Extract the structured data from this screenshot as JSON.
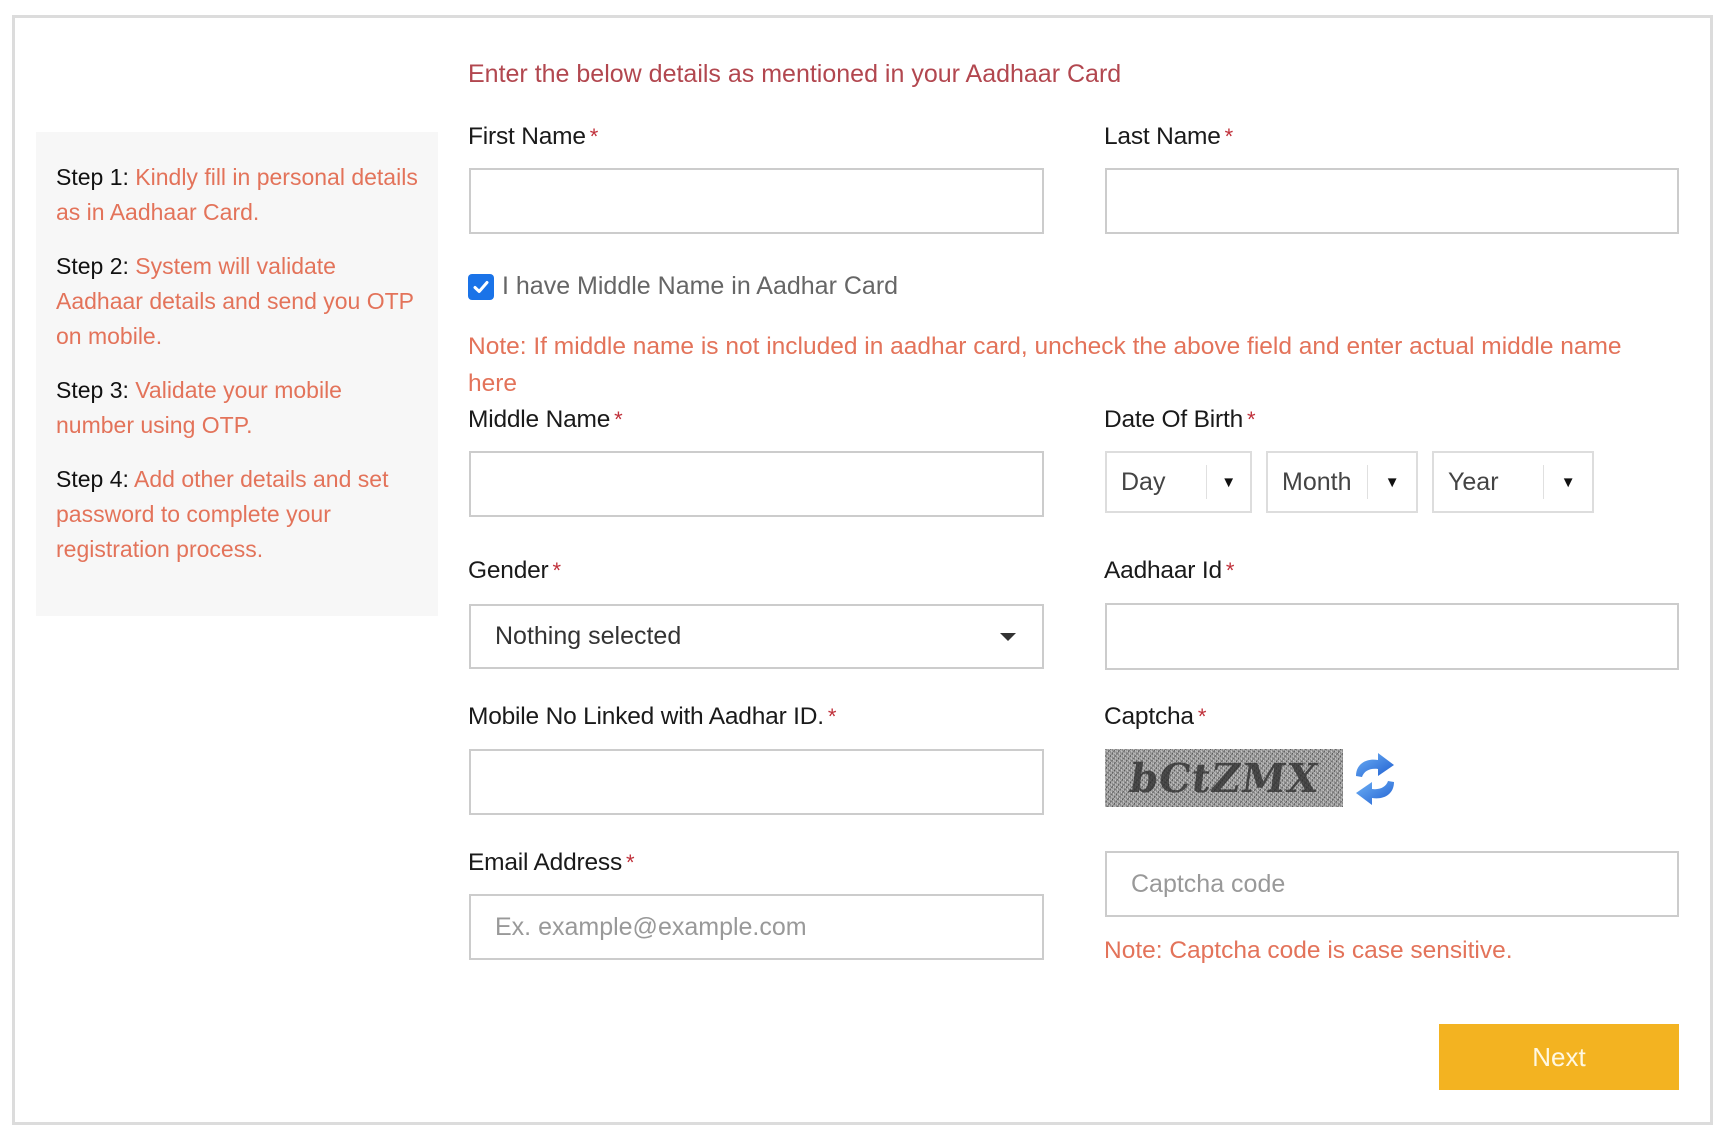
{
  "sidebar": {
    "steps": [
      {
        "prefix": "Step 1:",
        "text": "Kindly fill in personal details as in Aadhaar Card."
      },
      {
        "prefix": "Step 2:",
        "text": "System will validate Aadhaar details and send you OTP on mobile."
      },
      {
        "prefix": "Step 3:",
        "text": "Validate your mobile number using OTP."
      },
      {
        "prefix": "Step 4:",
        "text": "Add other details and set password to complete your registration process."
      }
    ]
  },
  "form": {
    "heading": "Enter the below details as mentioned in your Aadhaar Card",
    "required_marker": "*",
    "first_name": {
      "label": "First Name",
      "value": "",
      "placeholder": ""
    },
    "last_name": {
      "label": "Last Name",
      "value": "",
      "placeholder": ""
    },
    "middle_name_checkbox": {
      "label": "I have Middle Name in Aadhar Card",
      "checked": true
    },
    "middle_name_note": "Note: If middle name is not included in aadhar card, uncheck the above field and enter actual middle name here",
    "middle_name": {
      "label": "Middle Name",
      "value": "",
      "placeholder": ""
    },
    "dob": {
      "label": "Date Of Birth",
      "day": {
        "selected": "Day"
      },
      "month": {
        "selected": "Month"
      },
      "year": {
        "selected": "Year"
      }
    },
    "gender": {
      "label": "Gender",
      "selected": "Nothing selected"
    },
    "aadhaar_id": {
      "label": "Aadhaar Id",
      "value": "",
      "placeholder": ""
    },
    "mobile": {
      "label": "Mobile No Linked with Aadhar ID.",
      "value": "",
      "placeholder": ""
    },
    "captcha": {
      "label": "Captcha",
      "image_text": "bCtZMX",
      "refresh_icon": "refresh-icon",
      "input_placeholder": "Captcha code",
      "input_value": "",
      "note": "Note: Captcha code is case sensitive."
    },
    "email": {
      "label": "Email Address",
      "value": "",
      "placeholder": "Ex. example@example.com"
    },
    "next_label": "Next"
  },
  "colors": {
    "accent_orange": "#e3735a",
    "heading_red": "#b2474f",
    "required_red": "#c0303a",
    "button_yellow": "#f3b321",
    "checkbox_blue": "#1a73e8",
    "sidebar_bg": "#f7f7f7"
  }
}
